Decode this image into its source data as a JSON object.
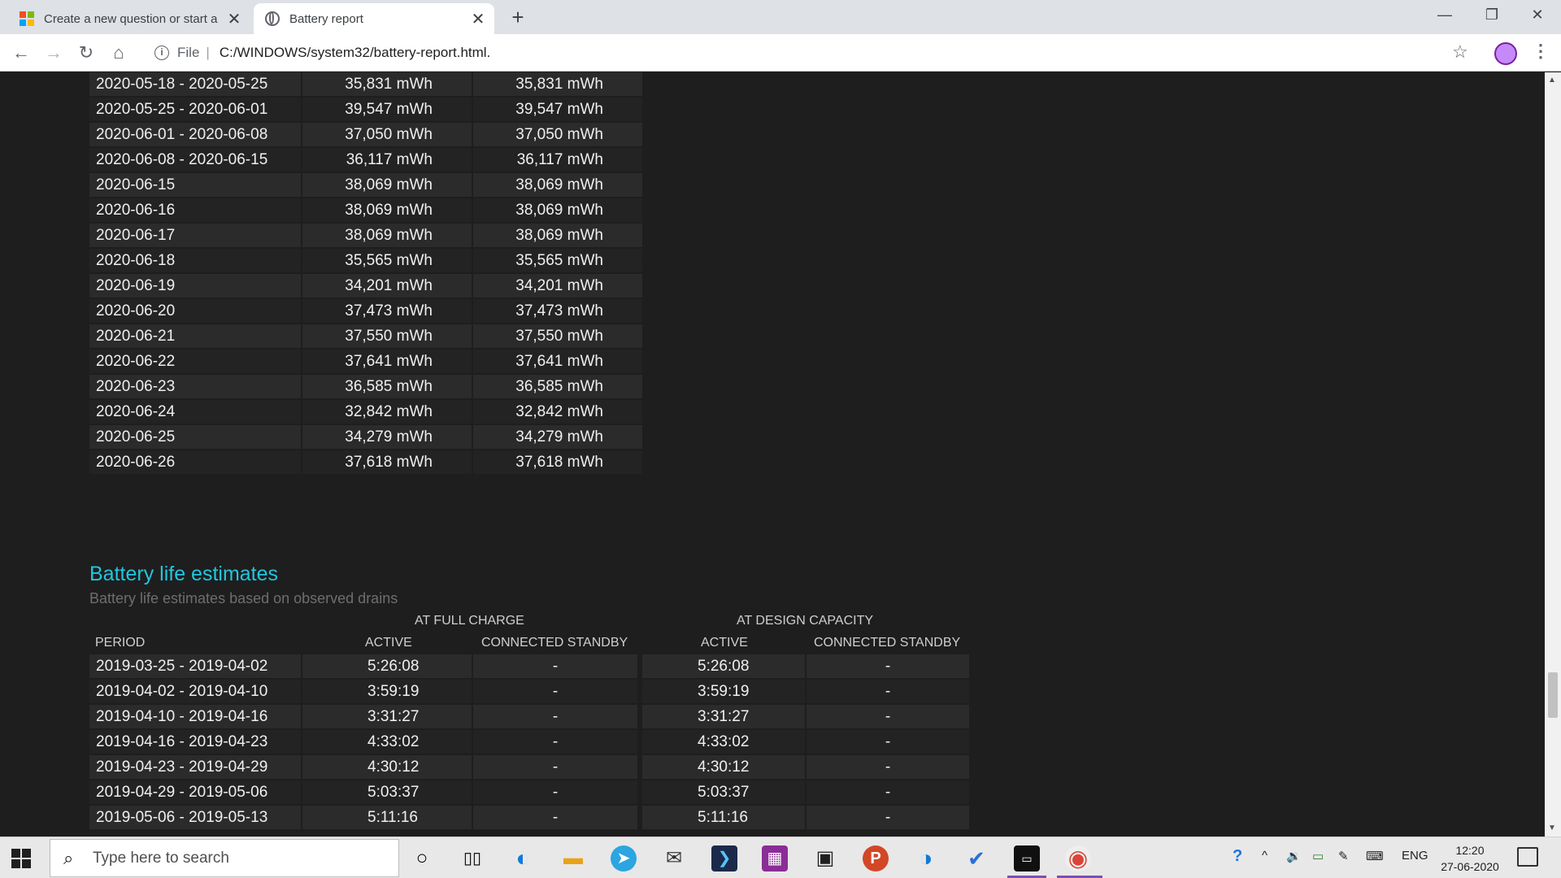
{
  "browser": {
    "tabs": [
      {
        "title": "Create a new question or start a",
        "close": "✕"
      },
      {
        "title": "Battery report",
        "close": "✕"
      }
    ],
    "new_tab": "+",
    "window": {
      "minimize": "—",
      "maximize": "❐",
      "close": "✕"
    },
    "toolbar": {
      "back": "←",
      "forward": "→",
      "reload": "↻",
      "home": "⌂"
    },
    "address": {
      "info": "i",
      "scheme": "File",
      "separator": "|",
      "url": "C:/WINDOWS/system32/battery-report.html."
    },
    "star": "☆",
    "menu": "⋮"
  },
  "capacity_history": {
    "rows": [
      [
        "2020-05-18 - 2020-05-25",
        "35,831 mWh",
        "35,831 mWh"
      ],
      [
        "2020-05-25 - 2020-06-01",
        "39,547 mWh",
        "39,547 mWh"
      ],
      [
        "2020-06-01 - 2020-06-08",
        "37,050 mWh",
        "37,050 mWh"
      ],
      [
        "2020-06-08 - 2020-06-15",
        "36,117 mWh",
        "36,117 mWh"
      ],
      [
        "2020-06-15",
        "38,069 mWh",
        "38,069 mWh"
      ],
      [
        "2020-06-16",
        "38,069 mWh",
        "38,069 mWh"
      ],
      [
        "2020-06-17",
        "38,069 mWh",
        "38,069 mWh"
      ],
      [
        "2020-06-18",
        "35,565 mWh",
        "35,565 mWh"
      ],
      [
        "2020-06-19",
        "34,201 mWh",
        "34,201 mWh"
      ],
      [
        "2020-06-20",
        "37,473 mWh",
        "37,473 mWh"
      ],
      [
        "2020-06-21",
        "37,550 mWh",
        "37,550 mWh"
      ],
      [
        "2020-06-22",
        "37,641 mWh",
        "37,641 mWh"
      ],
      [
        "2020-06-23",
        "36,585 mWh",
        "36,585 mWh"
      ],
      [
        "2020-06-24",
        "32,842 mWh",
        "32,842 mWh"
      ],
      [
        "2020-06-25",
        "34,279 mWh",
        "34,279 mWh"
      ],
      [
        "2020-06-26",
        "37,618 mWh",
        "37,618 mWh"
      ]
    ]
  },
  "battery_life": {
    "title": "Battery life estimates",
    "subtitle": "Battery life estimates based on observed drains",
    "group_full": "AT FULL CHARGE",
    "group_design": "AT DESIGN CAPACITY",
    "col_period": "PERIOD",
    "col_active": "ACTIVE",
    "col_standby": "CONNECTED STANDBY",
    "rows": [
      [
        "2019-03-25 - 2019-04-02",
        "5:26:08",
        "-",
        "5:26:08",
        "-"
      ],
      [
        "2019-04-02 - 2019-04-10",
        "3:59:19",
        "-",
        "3:59:19",
        "-"
      ],
      [
        "2019-04-10 - 2019-04-16",
        "3:31:27",
        "-",
        "3:31:27",
        "-"
      ],
      [
        "2019-04-16 - 2019-04-23",
        "4:33:02",
        "-",
        "4:33:02",
        "-"
      ],
      [
        "2019-04-23 - 2019-04-29",
        "4:30:12",
        "-",
        "4:30:12",
        "-"
      ],
      [
        "2019-04-29 - 2019-05-06",
        "5:03:37",
        "-",
        "5:03:37",
        "-"
      ],
      [
        "2019-05-06 - 2019-05-13",
        "5:11:16",
        "-",
        "5:11:16",
        "-"
      ]
    ]
  },
  "taskbar": {
    "search_placeholder": "Type here to search",
    "language": "ENG",
    "time": "12:20",
    "date": "27-06-2020",
    "colors": {
      "edge": "#0f7bd8",
      "telegram": "#2ca5e0",
      "powerpoint": "#d24726",
      "chrome_active": "#7a4fb5"
    }
  }
}
